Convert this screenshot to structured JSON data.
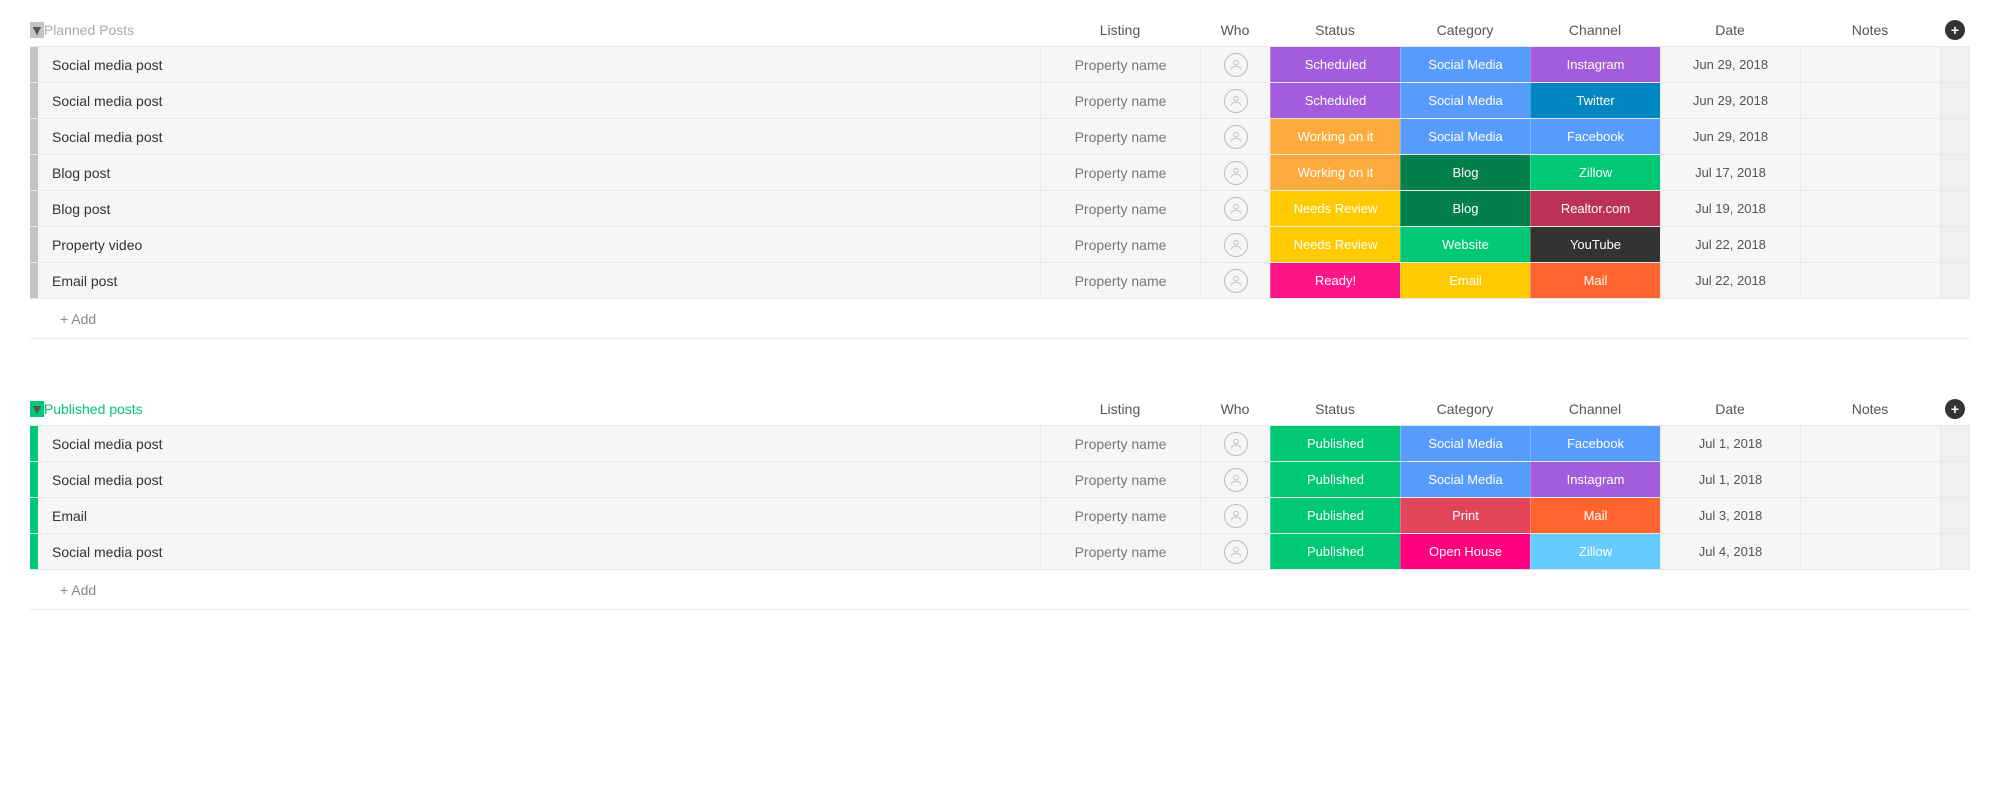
{
  "columns": {
    "listing": "Listing",
    "who": "Who",
    "status": "Status",
    "category": "Category",
    "channel": "Channel",
    "date": "Date",
    "notes": "Notes"
  },
  "add_label": "+ Add",
  "colors": {
    "purple": "#a25ddc",
    "blue": "#579bfc",
    "darkblue": "#0086c0",
    "orange": "#fdab3d",
    "yellow": "#ffcb00",
    "darkgreen": "#037f4c",
    "green": "#00c875",
    "brightgreen": "#00c875",
    "crimson": "#bb3354",
    "black": "#333333",
    "pink": "#ff158a",
    "hotpink": "#e2445c",
    "magenta": "#ff007f",
    "orangebright": "#ff642e",
    "lightblue": "#66ccff",
    "red": "#e2445c"
  },
  "groups": [
    {
      "id": "planned",
      "title": "Planned Posts",
      "accent": "#c4c4c4",
      "title_color": "#aaaaaa",
      "rows": [
        {
          "title": "Social media post",
          "listing": "Property name",
          "status": {
            "text": "Scheduled",
            "color": "#a25ddc"
          },
          "category": {
            "text": "Social Media",
            "color": "#579bfc"
          },
          "channel": {
            "text": "Instagram",
            "color": "#a25ddc"
          },
          "date": "Jun 29, 2018"
        },
        {
          "title": "Social media post",
          "listing": "Property name",
          "status": {
            "text": "Scheduled",
            "color": "#a25ddc"
          },
          "category": {
            "text": "Social Media",
            "color": "#579bfc"
          },
          "channel": {
            "text": "Twitter",
            "color": "#0086c0"
          },
          "date": "Jun 29, 2018"
        },
        {
          "title": "Social media post",
          "listing": "Property name",
          "status": {
            "text": "Working on it",
            "color": "#fdab3d"
          },
          "category": {
            "text": "Social Media",
            "color": "#579bfc"
          },
          "channel": {
            "text": "Facebook",
            "color": "#579bfc"
          },
          "date": "Jun 29, 2018"
        },
        {
          "title": "Blog post",
          "listing": "Property name",
          "status": {
            "text": "Working on it",
            "color": "#fdab3d"
          },
          "category": {
            "text": "Blog",
            "color": "#037f4c"
          },
          "channel": {
            "text": "Zillow",
            "color": "#00c875"
          },
          "date": "Jul 17, 2018"
        },
        {
          "title": "Blog post",
          "listing": "Property name",
          "status": {
            "text": "Needs Review",
            "color": "#ffcb00"
          },
          "category": {
            "text": "Blog",
            "color": "#037f4c"
          },
          "channel": {
            "text": "Realtor.com",
            "color": "#bb3354"
          },
          "date": "Jul 19, 2018"
        },
        {
          "title": "Property video",
          "listing": "Property name",
          "status": {
            "text": "Needs Review",
            "color": "#ffcb00"
          },
          "category": {
            "text": "Website",
            "color": "#00c875"
          },
          "channel": {
            "text": "YouTube",
            "color": "#333333"
          },
          "date": "Jul 22, 2018"
        },
        {
          "title": "Email post",
          "listing": "Property name",
          "status": {
            "text": "Ready!",
            "color": "#ff158a"
          },
          "category": {
            "text": "Email",
            "color": "#ffcb00"
          },
          "channel": {
            "text": "Mail",
            "color": "#ff642e"
          },
          "date": "Jul 22, 2018"
        }
      ]
    },
    {
      "id": "published",
      "title": "Published posts",
      "accent": "#00c875",
      "title_color": "#00c875",
      "rows": [
        {
          "title": "Social media post",
          "listing": "Property name",
          "status": {
            "text": "Published",
            "color": "#00c875"
          },
          "category": {
            "text": "Social Media",
            "color": "#579bfc"
          },
          "channel": {
            "text": "Facebook",
            "color": "#579bfc"
          },
          "date": "Jul 1, 2018"
        },
        {
          "title": "Social media post",
          "listing": "Property name",
          "status": {
            "text": "Published",
            "color": "#00c875"
          },
          "category": {
            "text": "Social Media",
            "color": "#579bfc"
          },
          "channel": {
            "text": "Instagram",
            "color": "#a25ddc"
          },
          "date": "Jul 1, 2018"
        },
        {
          "title": "Email",
          "listing": "Property name",
          "status": {
            "text": "Published",
            "color": "#00c875"
          },
          "category": {
            "text": "Print",
            "color": "#e2445c"
          },
          "channel": {
            "text": "Mail",
            "color": "#ff642e"
          },
          "date": "Jul 3, 2018"
        },
        {
          "title": "Social media post",
          "listing": "Property name",
          "status": {
            "text": "Published",
            "color": "#00c875"
          },
          "category": {
            "text": "Open House",
            "color": "#ff007f"
          },
          "channel": {
            "text": "Zillow",
            "color": "#66ccff"
          },
          "date": "Jul 4, 2018"
        }
      ]
    }
  ]
}
